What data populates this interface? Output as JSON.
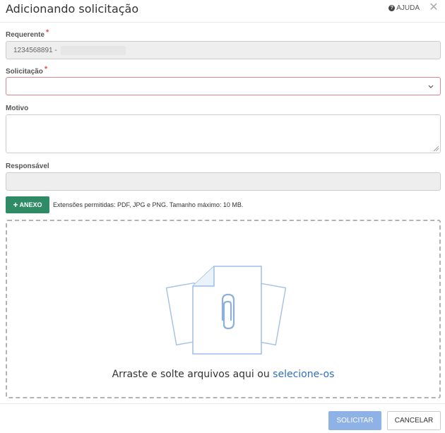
{
  "header": {
    "title": "Adicionando solicitação",
    "help_label": "AJUDA",
    "help_icon": "question-circle-icon",
    "close_icon": "close-icon"
  },
  "form": {
    "requerente": {
      "label": "Requerente",
      "required_mark": "*",
      "value": "1234568891 -"
    },
    "solicitacao": {
      "label": "Solicitação",
      "required_mark": "*",
      "value": ""
    },
    "motivo": {
      "label": "Motivo",
      "value": ""
    },
    "responsavel": {
      "label": "Responsável",
      "value": ""
    }
  },
  "attachment": {
    "button_label": "ANEXO",
    "button_icon": "plus-icon",
    "extensions_text": "Extensões permitidas: PDF, JPG e PNG. Tamanho máximo: 10 MB.",
    "drop_text": "Arraste e solte arquivos aqui ou",
    "select_link": "selecione-os"
  },
  "footer": {
    "submit_label": "SOLICITAR",
    "cancel_label": "CANCELAR"
  },
  "colors": {
    "anexo_button": "#2e8b66",
    "submit_button": "#8fb2e6",
    "link": "#2f6ec4",
    "required_border": "#e4868d",
    "required_mark": "#d9534f"
  }
}
